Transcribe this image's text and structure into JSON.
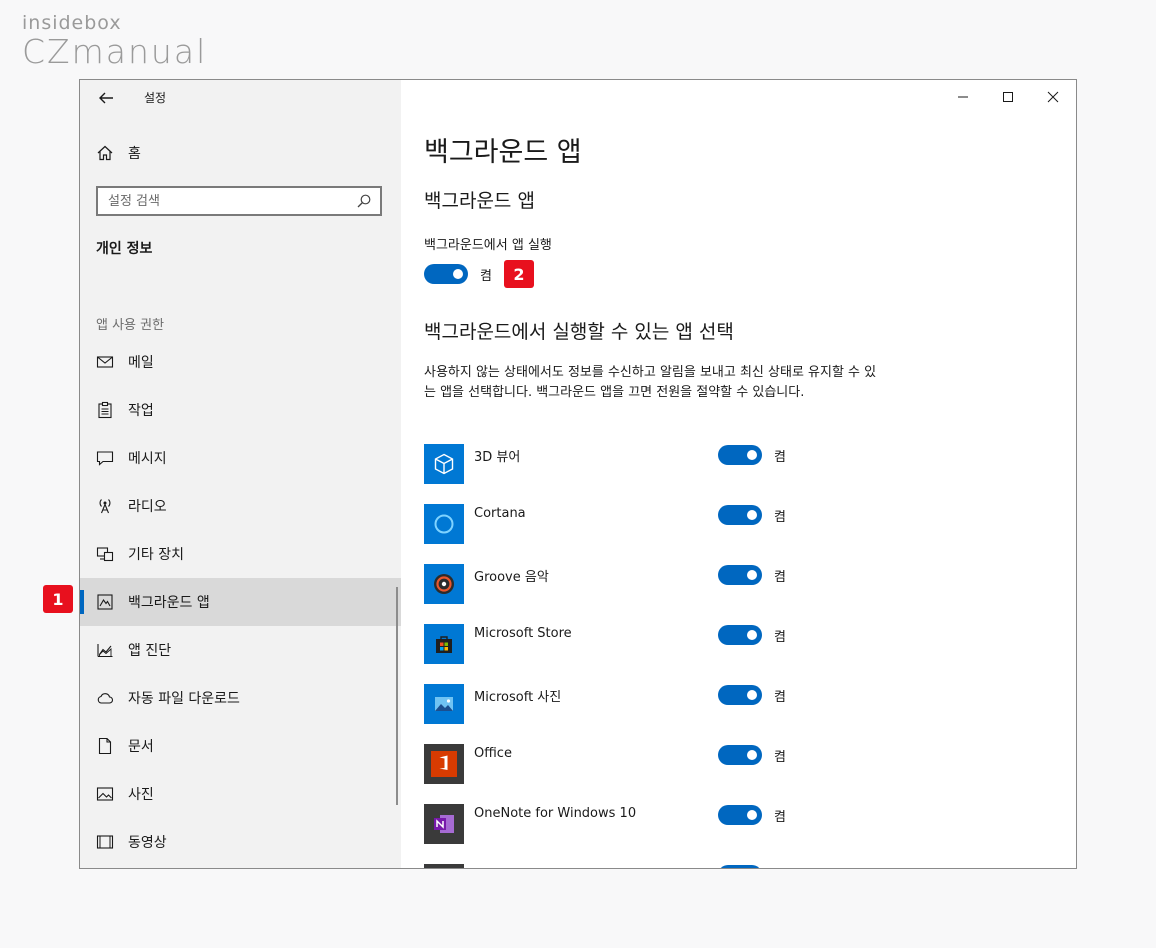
{
  "watermark": {
    "line1": "insidebox",
    "line2": "CZmanual"
  },
  "window": {
    "title": "설정"
  },
  "sidebar": {
    "home_label": "홈",
    "search_placeholder": "설정 검색",
    "section_title": "개인 정보",
    "group_label": "앱 사용 권한",
    "items": [
      {
        "label": "메일",
        "icon": "mail-icon"
      },
      {
        "label": "작업",
        "icon": "clipboard-icon"
      },
      {
        "label": "메시지",
        "icon": "message-icon"
      },
      {
        "label": "라디오",
        "icon": "radio-antenna-icon"
      },
      {
        "label": "기타 장치",
        "icon": "devices-icon"
      },
      {
        "label": "백그라운드 앱",
        "icon": "background-apps-icon",
        "selected": true
      },
      {
        "label": "앱 진단",
        "icon": "diagnostics-chart-icon"
      },
      {
        "label": "자동 파일 다운로드",
        "icon": "cloud-icon"
      },
      {
        "label": "문서",
        "icon": "document-icon"
      },
      {
        "label": "사진",
        "icon": "picture-icon"
      },
      {
        "label": "동영상",
        "icon": "video-icon"
      }
    ]
  },
  "content": {
    "page_title": "백그라운드 앱",
    "subtitle": "백그라운드 앱",
    "master_toggle_label": "백그라운드에서 앱 실행",
    "master_toggle_state": "켬",
    "choose_title": "백그라운드에서 실행할 수 있는 앱 선택",
    "description": "사용하지 않는 상태에서도 정보를 수신하고 알림을 보내고 최신 상태로 유지할 수 있는 앱을 선택합니다. 백그라운드 앱을 끄면 전원을 절약할 수 있습니다.",
    "apps": [
      {
        "name": "3D 뷰어",
        "state": "켬",
        "icon": "3d-cube-icon"
      },
      {
        "name": "Cortana",
        "state": "켬",
        "icon": "cortana-ring-icon"
      },
      {
        "name": "Groove 음악",
        "state": "켬",
        "icon": "groove-disc-icon"
      },
      {
        "name": "Microsoft Store",
        "state": "켬",
        "icon": "store-bag-icon"
      },
      {
        "name": "Microsoft 사진",
        "state": "켬",
        "icon": "photos-icon"
      },
      {
        "name": "Office",
        "state": "켬",
        "icon": "office-icon"
      },
      {
        "name": "OneNote for Windows 10",
        "state": "켬",
        "icon": "onenote-icon"
      }
    ]
  },
  "annotations": {
    "badge1": "1",
    "badge2": "2"
  },
  "colors": {
    "accent": "#0067c0",
    "badge": "#e8101e",
    "sidebar_bg": "#f2f2f2",
    "tile_blue": "#0078d4"
  }
}
